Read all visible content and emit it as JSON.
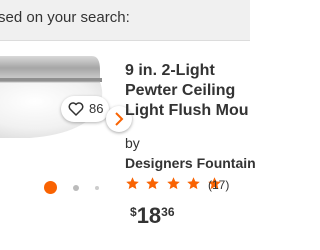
{
  "page": {
    "caption": "sed on your search:"
  },
  "product": {
    "favorite_count": "86",
    "title": "9 in. 2-Light\nPewter Ceiling\nLight Flush Mou",
    "by_label": "by",
    "brand": "Designers Fountain",
    "rating": 5,
    "review_count": "(17)",
    "price": {
      "symbol": "$",
      "dollars": "18",
      "cents": "36"
    },
    "image_count_dots": 3,
    "active_image": 1
  },
  "colors": {
    "accent": "#f96302",
    "background": "#ffffff",
    "caption_bg": "#f0f0f0"
  },
  "icons": {
    "favorite": "heart-icon",
    "next": "chevron-right-icon",
    "star": "star-icon"
  }
}
